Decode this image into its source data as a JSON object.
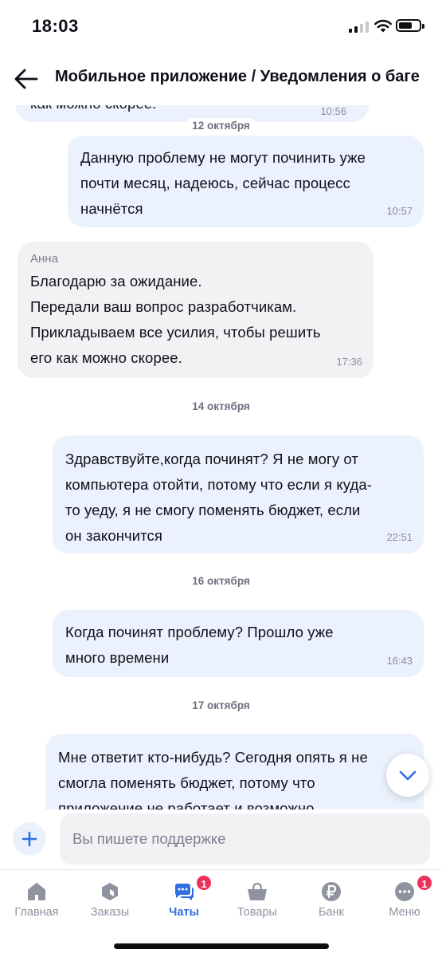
{
  "status_bar": {
    "time": "18:03"
  },
  "header": {
    "title": "Мобильное приложение / Уведомления о баге"
  },
  "messages": [
    {
      "type": "out",
      "text": "как можно скорее.",
      "time": "10:56"
    },
    {
      "type": "date",
      "text": "12 октября"
    },
    {
      "type": "out",
      "text": "Данную проблему не могут починить уже\nпочти месяц, надеюсь, сейчас процесс\nначнётся",
      "time": "10:57"
    },
    {
      "type": "in",
      "author": "Анна",
      "text": "Благодарю за ожидание.\nПередали ваш вопрос разработчикам.\nПрикладываем все усилия, чтобы решить\nего как можно скорее.",
      "time": "17:36"
    },
    {
      "type": "date",
      "text": "14 октября"
    },
    {
      "type": "out",
      "text": "Здравствуйте,когда починят? Я не могу от\nкомпьютера отойти, потому что если я куда-\nто уеду, я не смогу поменять бюджет, если\nон закончится",
      "time": "22:51"
    },
    {
      "type": "date",
      "text": "16 октября"
    },
    {
      "type": "out",
      "text": "Когда починят проблему? Прошло уже\nмного времени",
      "time": "16:43"
    },
    {
      "type": "date",
      "text": "17 октября"
    },
    {
      "type": "out",
      "text": "Мне ответит кто-нибудь? Сегодня опять я не\nсмогла поменять бюджет, потому что\nприложение не работает и возможно",
      "time": ""
    }
  ],
  "composer": {
    "placeholder": "Вы пишете поддержке"
  },
  "tabs": [
    {
      "label": "Главная",
      "icon": "home-icon",
      "badge": ""
    },
    {
      "label": "Заказы",
      "icon": "orders-icon",
      "badge": ""
    },
    {
      "label": "Чаты",
      "icon": "chats-icon",
      "badge": "1",
      "active": true
    },
    {
      "label": "Товары",
      "icon": "basket-icon",
      "badge": ""
    },
    {
      "label": "Банк",
      "icon": "ruble-icon",
      "badge": ""
    },
    {
      "label": "Меню",
      "icon": "menu-dots-icon",
      "badge": "1"
    }
  ],
  "colors": {
    "accent": "#2f6fe0",
    "outgoing_bubble": "#ebf2fd",
    "incoming_bubble": "#f2f2f5",
    "badge": "#ee2f5a",
    "tab_inactive": "#8f93a0"
  }
}
